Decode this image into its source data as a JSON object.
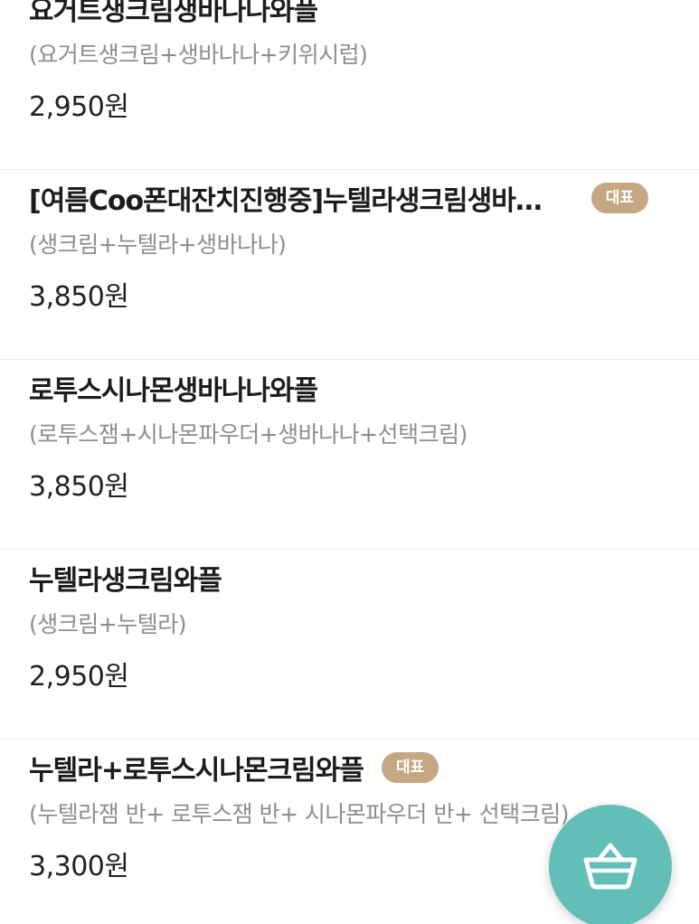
{
  "menu_items": [
    {
      "title": "요거트생크림생바나나와플",
      "description": "(요거트생크림+생바나나+키위시럽)",
      "price": "2,950원",
      "badge": ""
    },
    {
      "title": "[여름Coo폰대잔치진행중]누텔라생크림생바나나와플",
      "description": "(생크림+누텔라+생바나나)",
      "price": "3,850원",
      "badge": "대표"
    },
    {
      "title": "로투스시나몬생바나나와플",
      "description": "(로투스잼+시나몬파우더+생바나나+선택크림)",
      "price": "3,850원",
      "badge": ""
    },
    {
      "title": "누텔라생크림와플",
      "description": "(생크림+누텔라)",
      "price": "2,950원",
      "badge": ""
    },
    {
      "title": "누텔라+로투스시나몬크림와플",
      "description": "(누텔라잼 반+ 로투스잼 반+ 시나몬파우더 반+ 선택크림)",
      "price": "3,300원",
      "badge": "대표"
    }
  ],
  "cart_button": {
    "icon": "basket-icon",
    "color": "#63beb8"
  },
  "colors": {
    "badge": "#c4a783",
    "cart_fab": "#63beb8",
    "title": "#1c1c1c",
    "description": "#8e8e8e",
    "divider": "#ececec"
  }
}
